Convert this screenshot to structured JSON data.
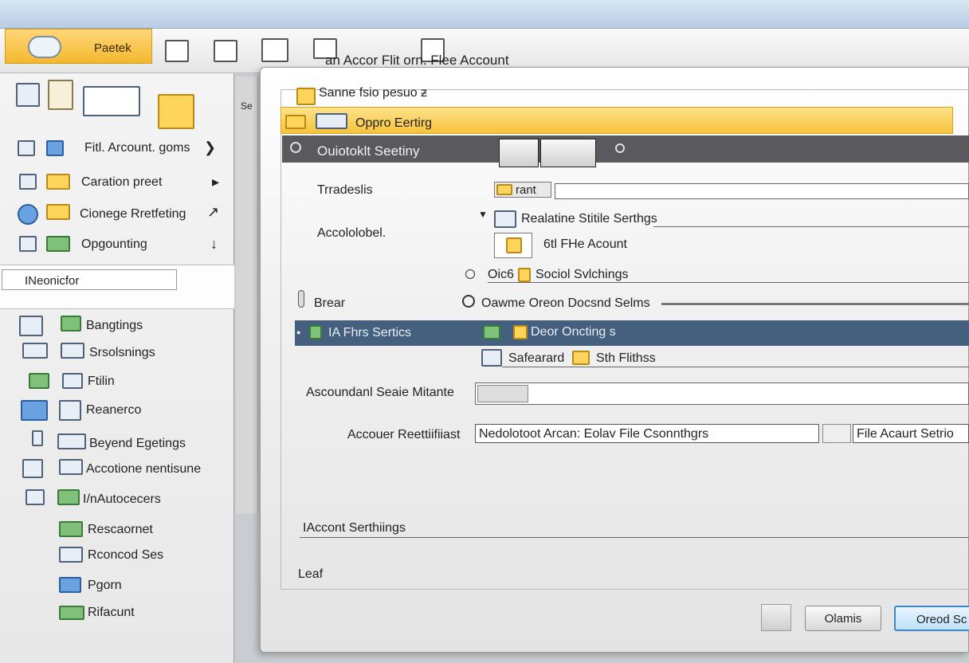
{
  "ribbon": {
    "orb_label": "Paetek",
    "title": "an Accor Flit  orn. Flee Account"
  },
  "nav": {
    "items": [
      {
        "label": "Fitl. Arcount. goms",
        "arrow": "❯"
      },
      {
        "label": "Caration preet",
        "arrow": "▸"
      },
      {
        "label": "Cionege Rretfeting",
        "arrow": "↗"
      },
      {
        "label": "Opgounting",
        "arrow": "↓"
      }
    ],
    "search_value": "INeonicfor",
    "settings_items": [
      "Bangtings",
      "Srsolsnings",
      "Ftilin",
      "Reanerco",
      "Beyend Egetings",
      "Accotione nentisune",
      "I/nAutocecers",
      "Rescaornet",
      "Rconcod Ses",
      "Pgorn",
      "Rifacunt"
    ]
  },
  "splitter_label": "Se",
  "dialog": {
    "title": "Sanne fsio pesuo ƶ",
    "yellow_bar_label": "Oppro Eertirg",
    "dark_bar_label": "Ouiotoklt Seetiny",
    "row_tradeslis": "Trradeslis",
    "row_tradeslis_input": "rant",
    "realtime_label": "Realatine Stitile Serthgs",
    "accolobel_label": "Accololobel.",
    "fle_account": "6tl FHe Acount",
    "oieg_label": "Oic6",
    "social_label": "Sociol Svlchings",
    "brear_label": "Brear",
    "ownme_label": "Oawme Oreon Docsnd Selms",
    "blue_row_left": "IA  Fhrs Sertics",
    "blue_row_right": "Deor Oncting s",
    "safecard_label": "Safearard",
    "sth_label": "Sth Flithss",
    "acct_secure_label": "Ascoundanl Seaie Mitante",
    "accouer_label": "Accouer Reettiifiiast",
    "accouer_input": "Nedolotoot Arcan: Eolav File Csonnthgrs",
    "accouer_input2": "File Acaurt Setrio",
    "account_settings_label": "IAccont Serthiings",
    "leaf_label": "Leaf",
    "cancel_label": "Olamis",
    "ok_label": "Oreod Sc"
  }
}
